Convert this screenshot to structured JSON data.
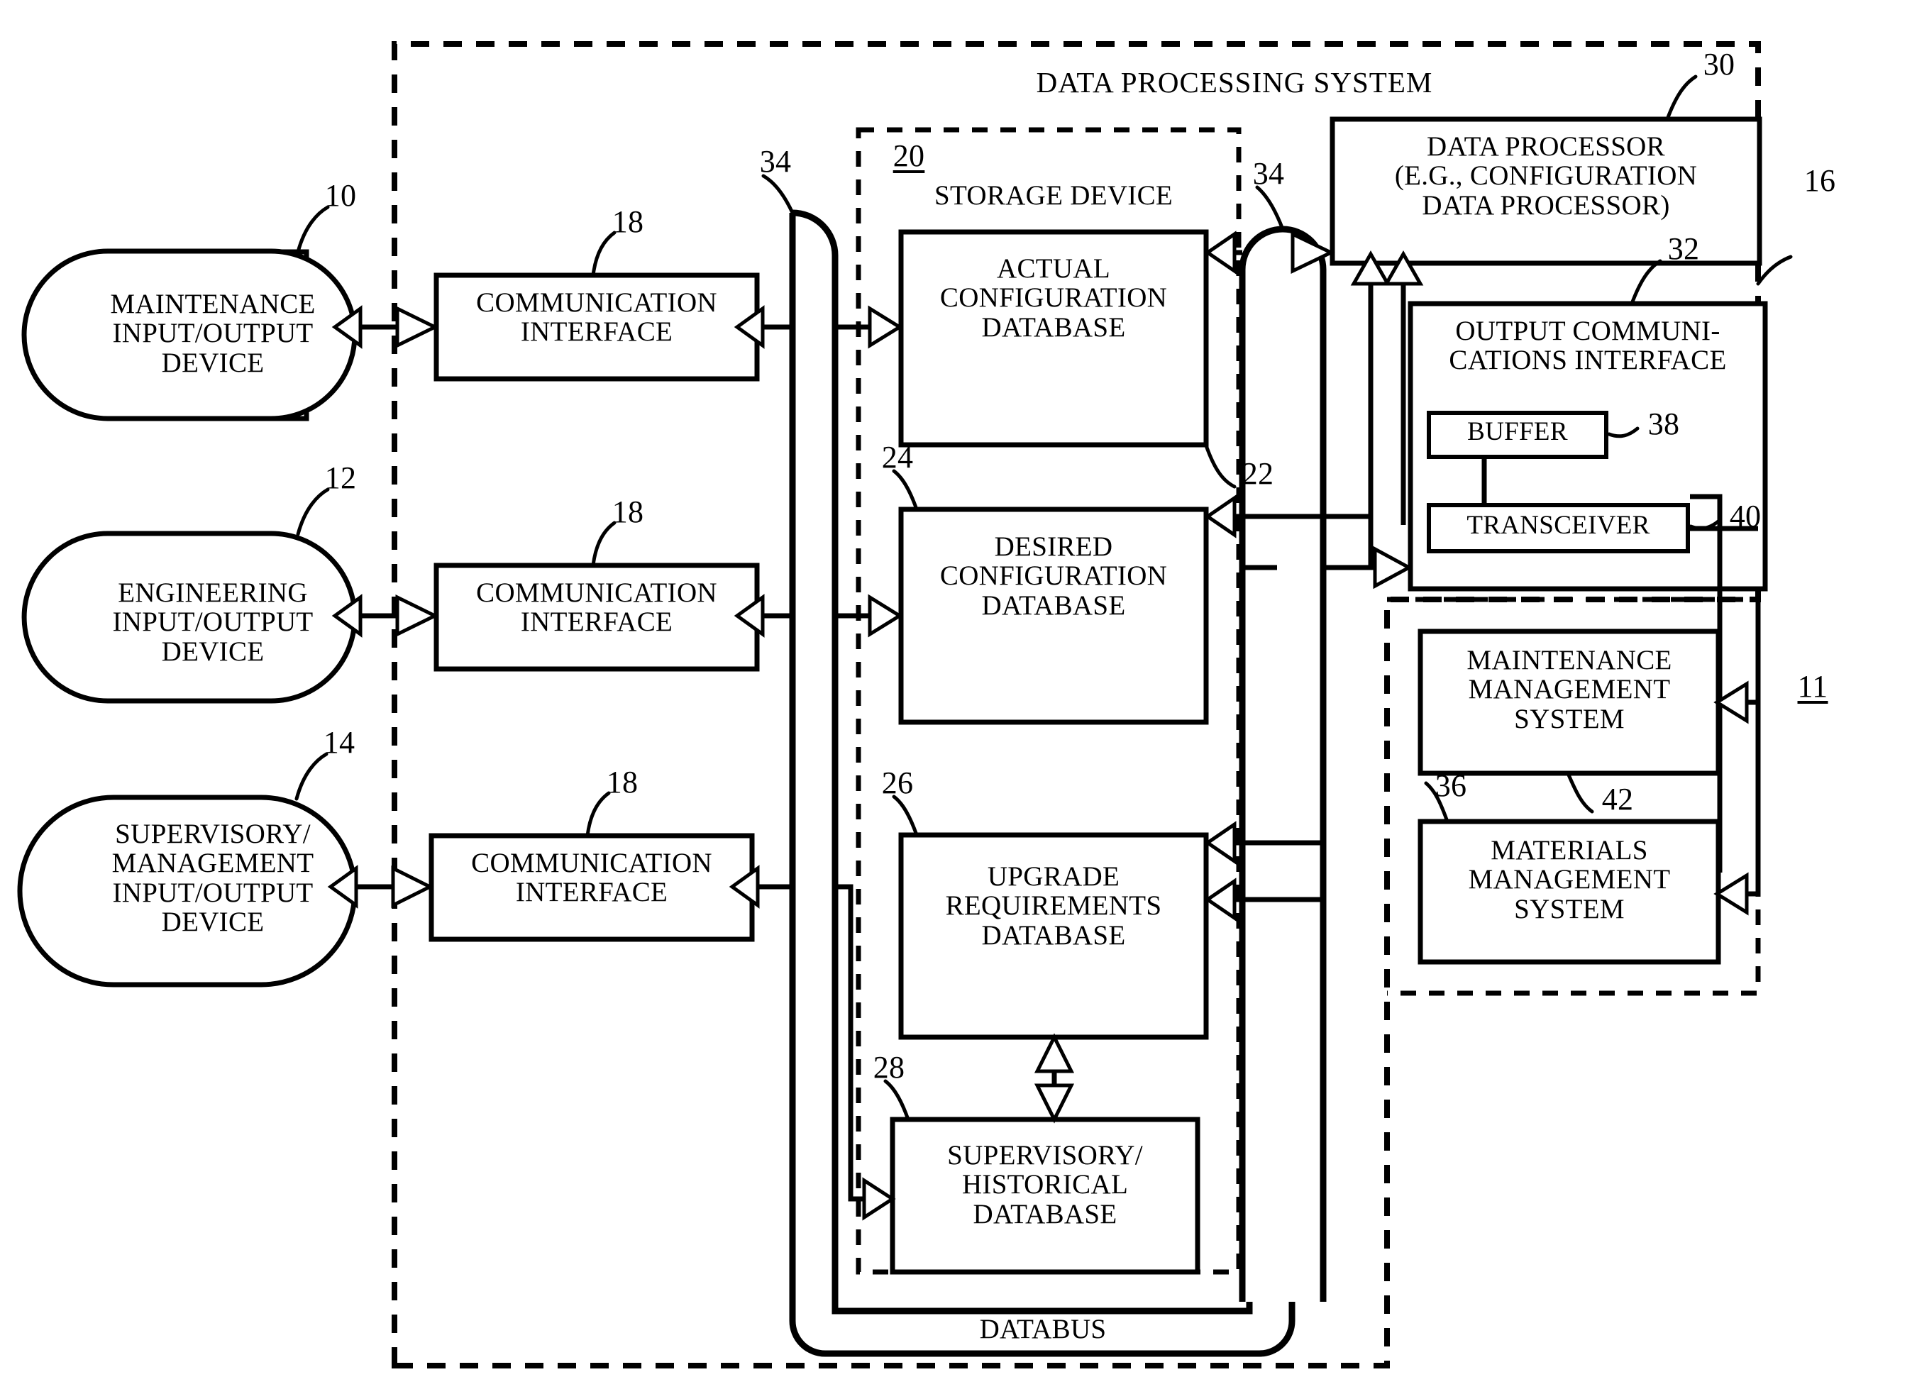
{
  "figure": {
    "type": "patent-block-diagram",
    "system_title": "DATA PROCESSING SYSTEM",
    "databus_label": "DATABUS",
    "storage_device_label": "STORAGE DEVICE"
  },
  "io_devices": [
    {
      "name": "maintenance-io",
      "label": "MAINTENANCE\nINPUT/OUTPUT\nDEVICE",
      "ref": "10"
    },
    {
      "name": "engineering-io",
      "label": "ENGINEERING\nINPUT/OUTPUT\nDEVICE",
      "ref": "12"
    },
    {
      "name": "supervisory-io",
      "label": "SUPERVISORY/\nMANAGEMENT\nINPUT/OUTPUT\nDEVICE",
      "ref": "14"
    }
  ],
  "comm_interfaces": [
    {
      "label": "COMMUNICATION\nINTERFACE",
      "ref": "18"
    },
    {
      "label": "COMMUNICATION\nINTERFACE",
      "ref": "18"
    },
    {
      "label": "COMMUNICATION\nINTERFACE",
      "ref": "18"
    }
  ],
  "databases": [
    {
      "name": "actual-configuration-database",
      "label": "ACTUAL\nCONFIGURATION\nDATABASE",
      "ref": "22"
    },
    {
      "name": "desired-configuration-database",
      "label": "DESIRED\nCONFIGURATION\nDATABASE",
      "ref": "24"
    },
    {
      "name": "upgrade-requirements-database",
      "label": "UPGRADE\nREQUIREMENTS\nDATABASE",
      "ref": "26"
    },
    {
      "name": "supervisory-historical-database",
      "label": "SUPERVISORY/\nHISTORICAL\nDATABASE",
      "ref": "28"
    }
  ],
  "processor": {
    "label": "DATA PROCESSOR\n(E.G., CONFIGURATION\nDATA PROCESSOR)",
    "ref": "30"
  },
  "output_comm": {
    "label": "OUTPUT COMMUNI-\nCATIONS INTERFACE",
    "ref": "32",
    "buffer": {
      "label": "BUFFER",
      "ref": "38"
    },
    "transceiver": {
      "label": "TRANSCEIVER",
      "ref": "40"
    }
  },
  "external_systems": [
    {
      "name": "maintenance-management-system",
      "label": "MAINTENANCE\nMANAGEMENT\nSYSTEM",
      "ref": "42"
    },
    {
      "name": "materials-management-system",
      "label": "MATERIALS\nMANAGEMENT\nSYSTEM",
      "ref": "36"
    }
  ],
  "refs": {
    "storage_device": "20",
    "databus_left": "34",
    "databus_right": "34",
    "system_boundary": "16",
    "external_boundary": "11"
  }
}
